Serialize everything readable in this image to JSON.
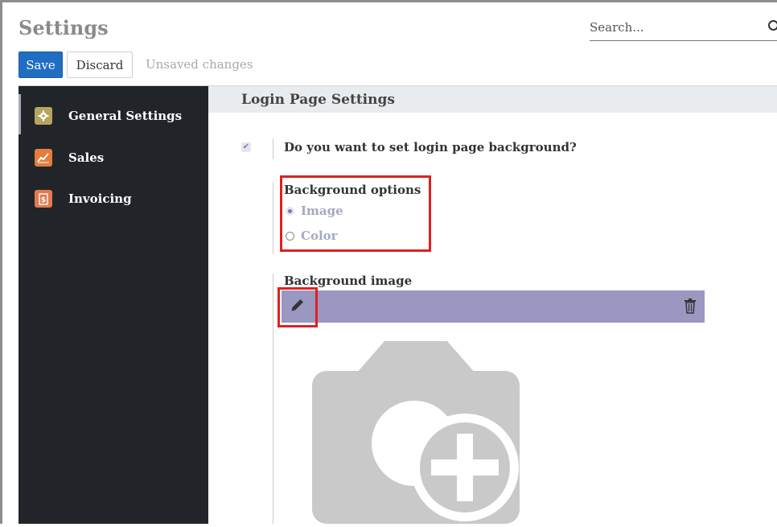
{
  "control_panel": {
    "title": "Settings",
    "search_placeholder": "Search...",
    "save_label": "Save",
    "discard_label": "Discard",
    "status_text": "Unsaved changes"
  },
  "sidebar": {
    "items": [
      {
        "label": "General Settings",
        "icon": "gear-icon",
        "color": "#b5a55f",
        "active": true
      },
      {
        "label": "Sales",
        "icon": "chart-line-icon",
        "color": "#e57c3d",
        "active": false
      },
      {
        "label": "Invoicing",
        "icon": "invoice-icon",
        "color": "#e07b4f",
        "active": false
      }
    ]
  },
  "main": {
    "section_title": "Login Page Settings",
    "background_setting": {
      "question": "Do you want to set login page background?",
      "checked": true
    },
    "background_options": {
      "label": "Background options",
      "options": [
        {
          "label": "Image",
          "selected": true
        },
        {
          "label": "Color",
          "selected": false
        }
      ]
    },
    "background_image": {
      "label": "Background image",
      "edit_icon": "pencil-icon",
      "delete_icon": "trash-icon",
      "placeholder_icon": "camera-plus-icon"
    }
  },
  "colors": {
    "accent": "#7c7bad",
    "brand_bar": "#9a97c1",
    "save_button": "#1f6ec2",
    "sidebar_bg": "#212529",
    "highlight": "#e02020"
  }
}
